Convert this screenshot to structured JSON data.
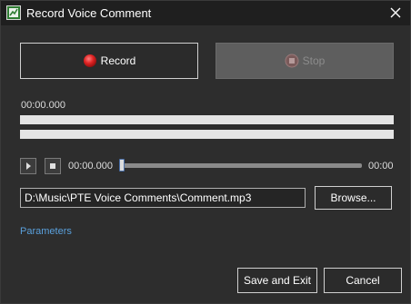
{
  "window": {
    "title": "Record Voice Comment"
  },
  "controls": {
    "record_label": "Record",
    "stop_label": "Stop"
  },
  "recording": {
    "elapsed_time": "00:00.000"
  },
  "playback": {
    "position_time": "00:00.000",
    "total_time": "00:00",
    "position_fraction": 0
  },
  "file": {
    "path": "D:\\Music\\PTE Voice Comments\\Comment.mp3",
    "browse_label": "Browse..."
  },
  "parameters_link": "Parameters",
  "footer": {
    "save_label": "Save and Exit",
    "cancel_label": "Cancel"
  },
  "colors": {
    "background": "#2d2d2d",
    "titlebar": "#1f1f1f",
    "record_icon": "#d42020",
    "link": "#5aa0dc",
    "disabled_button": "#5e5e5e",
    "level_bar": "#e4e4e4"
  },
  "icons": {
    "app": "app-logo-icon",
    "close": "close-icon",
    "record": "record-dot-icon",
    "stop": "stop-square-icon",
    "play": "play-icon",
    "stop_small": "stop-icon"
  }
}
